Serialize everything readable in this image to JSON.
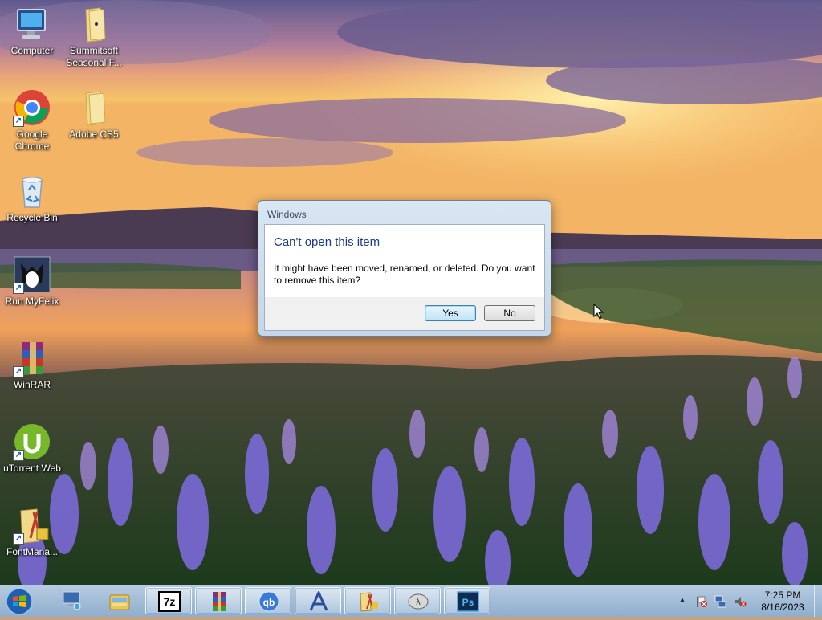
{
  "desktop": {
    "icons": [
      {
        "label": "Computer",
        "icon": "computer-icon"
      },
      {
        "label": "Summitsoft Seasonal F...",
        "icon": "folder-icon"
      },
      {
        "label": "Google Chrome",
        "icon": "chrome-icon"
      },
      {
        "label": "Adobe CS5",
        "icon": "folder-icon"
      },
      {
        "label": "Recycle Bin",
        "icon": "recycle-bin-icon"
      },
      {
        "label": "Run MyFelix",
        "icon": "myfelix-icon"
      },
      {
        "label": "WinRAR",
        "icon": "winrar-icon"
      },
      {
        "label": "uTorrent Web",
        "icon": "utorrent-icon"
      },
      {
        "label": "FontMana...",
        "icon": "font-manager-icon"
      }
    ]
  },
  "dialog": {
    "title": "Windows",
    "heading": "Can't open this item",
    "message": "It might have been moved, renamed, or deleted. Do you want to remove this item?",
    "yes_label": "Yes",
    "no_label": "No"
  },
  "taskbar": {
    "start": "windows-start-orb",
    "items": [
      {
        "name": "network-computer-icon"
      },
      {
        "name": "windows-explorer-icon"
      },
      {
        "name": "7zip-icon",
        "text": "7z"
      },
      {
        "name": "winrar-icon"
      },
      {
        "name": "qbittorrent-icon",
        "text": "qb"
      },
      {
        "name": "font-app-icon"
      },
      {
        "name": "adobe-folder-icon"
      },
      {
        "name": "app-icon"
      },
      {
        "name": "photoshop-icon",
        "text": "Ps"
      }
    ],
    "tray": {
      "icons": [
        "show-hidden-icons-chevron",
        "action-center-flag-icon",
        "network-icon",
        "volume-muted-icon"
      ]
    },
    "clock": {
      "time": "7:25 PM",
      "date": "8/16/2023"
    }
  },
  "colors": {
    "dialog_heading": "#1e3b8a",
    "taskbar": "#a9c4e0",
    "default_button": "#bfe3f7"
  }
}
